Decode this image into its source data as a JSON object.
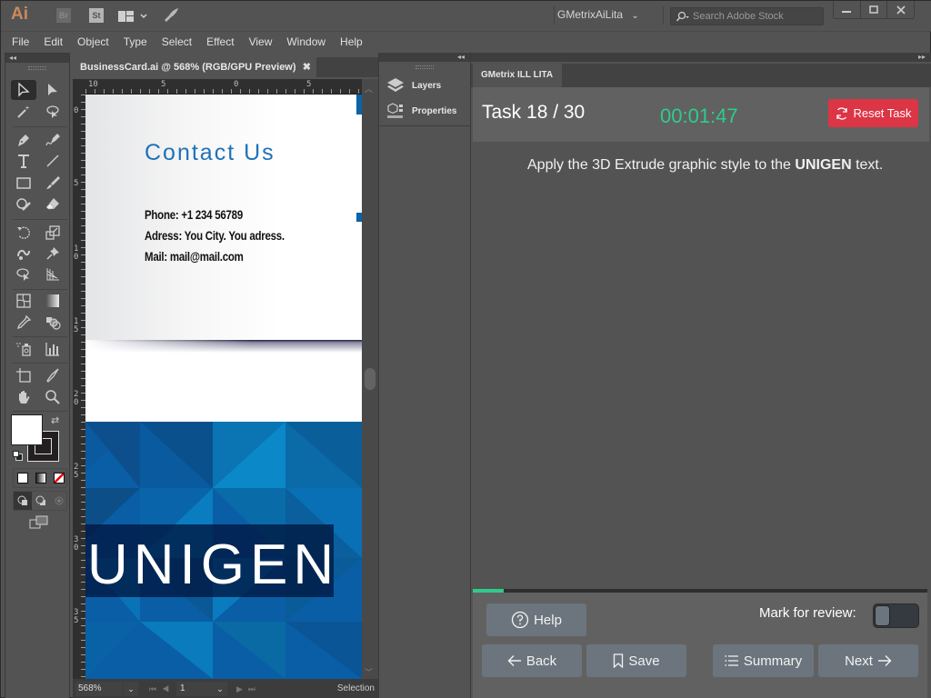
{
  "titlebar": {
    "app_logo": "Ai",
    "bridge_label": "Br",
    "stock_label": "St",
    "workspace": "GMetrixAiLita",
    "stock_search_placeholder": "Search Adobe Stock",
    "minimize": "—",
    "maximize": "☐",
    "close": "✕"
  },
  "menubar": [
    "File",
    "Edit",
    "Object",
    "Type",
    "Select",
    "Effect",
    "View",
    "Window",
    "Help"
  ],
  "toolbar": {
    "collapse": "◂◂",
    "tools": [
      "selection",
      "direct-selection",
      "magic-wand",
      "lasso",
      "pen",
      "curvature",
      "type",
      "line-segment",
      "rectangle",
      "paintbrush",
      "shaper",
      "eraser",
      "rotate",
      "scale",
      "warp",
      "puppet-warp",
      "free-transform",
      "perspective-grid",
      "mesh",
      "gradient",
      "eyedropper",
      "blend",
      "symbol-sprayer",
      "column-graph",
      "artboard",
      "slice",
      "hand",
      "zoom"
    ],
    "fill_color": "#ffffff",
    "stroke_color": "#231f20",
    "swap_label": "⇄",
    "color_modes": [
      "color",
      "gradient",
      "none"
    ],
    "draw_modes": [
      "draw-normal",
      "draw-behind",
      "draw-inside"
    ],
    "screen_mode": "change-screen-mode"
  },
  "document": {
    "tab_title": "BusinessCard.ai @ 568% (RGB/GPU Preview)",
    "tab_close": "✖",
    "ruler_top": [
      "10",
      "5",
      "0",
      "5"
    ],
    "ruler_left": [
      "0",
      "5",
      "10",
      "15",
      "20",
      "25",
      "30",
      "35"
    ],
    "artwork": {
      "contact_title": "Contact Us",
      "phone": "Phone: +1 234 56789",
      "address": "Adress: You City. You adress.",
      "mail": "Mail: mail@mail.com",
      "brand": "UNIGEN"
    },
    "status": {
      "zoom": "568%",
      "page": "1",
      "tool": "Selection"
    }
  },
  "midpanel": {
    "collapse": "◂◂",
    "items": [
      {
        "label": "Layers",
        "icon": "layers-icon"
      },
      {
        "label": "Properties",
        "icon": "properties-icon"
      }
    ]
  },
  "gmetrix": {
    "collapse": "▸▸",
    "tab": "GMetrix ILL LITA",
    "task_label": "Task 18 / 30",
    "timer": "00:01:47",
    "reset_label": "Reset Task",
    "instruction_pre": "Apply the 3D Extrude graphic style to the ",
    "instruction_bold": "UNIGEN",
    "instruction_post": " text.",
    "progress_percent": 6.7,
    "help_label": "Help",
    "mark_review_label": "Mark for review:",
    "mark_review_on": false,
    "back_label": "Back",
    "save_label": "Save",
    "summary_label": "Summary",
    "next_label": "Next",
    "colors": {
      "accent_green": "#2ecc8b",
      "reset_red": "#dc3545",
      "button_gray": "#6c757d"
    }
  }
}
